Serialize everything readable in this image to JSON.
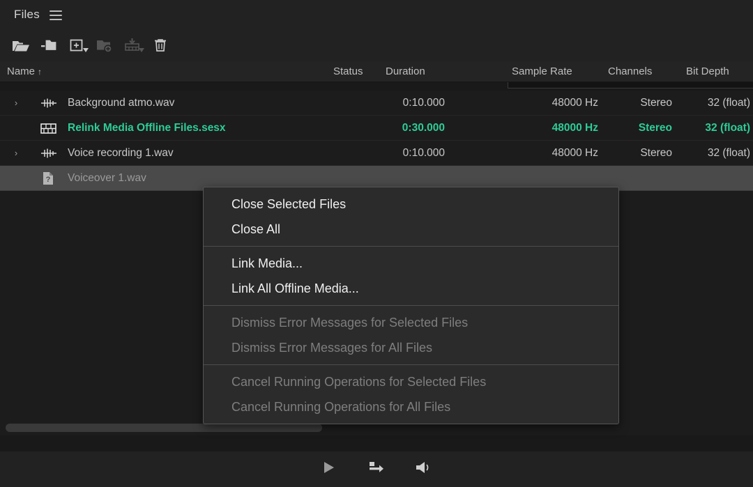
{
  "panel": {
    "title": "Files",
    "menu_icon": "hamburger-panel-menu-icon"
  },
  "toolbar": {
    "buttons": [
      {
        "name": "open-file",
        "icon": "open-folder-icon",
        "enabled": true,
        "has_dropdown": false
      },
      {
        "name": "import-file",
        "icon": "import-folder-arrow-icon",
        "enabled": true,
        "has_dropdown": false
      },
      {
        "name": "new-file",
        "icon": "new-file-plus-icon",
        "enabled": true,
        "has_dropdown": true
      },
      {
        "name": "new-folder",
        "icon": "new-folder-plus-icon",
        "enabled": false,
        "has_dropdown": false
      },
      {
        "name": "import-cd-track",
        "icon": "cd-import-down-arrow-icon",
        "enabled": false,
        "has_dropdown": true
      },
      {
        "name": "close-selected",
        "icon": "trash-can-icon",
        "enabled": true,
        "has_dropdown": false
      }
    ]
  },
  "search": {
    "icon": "search-magnifier-icon",
    "value": "",
    "placeholder": ""
  },
  "columns": [
    {
      "label": "Name",
      "sort": "↑"
    },
    {
      "label": "Status",
      "sort": ""
    },
    {
      "label": "Duration",
      "sort": ""
    },
    {
      "label": "Sample Rate",
      "sort": ""
    },
    {
      "label": "Channels",
      "sort": ""
    },
    {
      "label": "Bit Depth",
      "sort": ""
    }
  ],
  "rows": [
    {
      "name": "Background atmo.wav",
      "icon": "audio-waveform-icon",
      "twisty": "›",
      "status": "",
      "duration": "0:10.000",
      "sample_rate": "48000 Hz",
      "channels": "Stereo",
      "bit_depth": "32 (float)",
      "state": "normal"
    },
    {
      "name": "Relink Media Offline Files.sesx",
      "icon": "multitrack-session-icon",
      "twisty": "",
      "status": "",
      "duration": "0:30.000",
      "sample_rate": "48000 Hz",
      "channels": "Stereo",
      "bit_depth": "32 (float)",
      "state": "highlight"
    },
    {
      "name": "Voice recording 1.wav",
      "icon": "audio-waveform-icon",
      "twisty": "›",
      "status": "",
      "duration": "0:10.000",
      "sample_rate": "48000 Hz",
      "channels": "Stereo",
      "bit_depth": "32 (float)",
      "state": "normal"
    },
    {
      "name": "Voiceover 1.wav",
      "icon": "offline-media-question-icon",
      "twisty": "",
      "status": "",
      "duration": "",
      "sample_rate": "",
      "channels": "",
      "bit_depth": "",
      "state": "selected"
    }
  ],
  "context_menu": {
    "groups": [
      {
        "items": [
          {
            "label": "Close Selected Files",
            "enabled": true
          },
          {
            "label": "Close All",
            "enabled": true
          }
        ]
      },
      {
        "items": [
          {
            "label": "Link Media...",
            "enabled": true
          },
          {
            "label": "Link All Offline Media...",
            "enabled": true
          }
        ]
      },
      {
        "items": [
          {
            "label": "Dismiss Error Messages for Selected Files",
            "enabled": false
          },
          {
            "label": "Dismiss Error Messages for All Files",
            "enabled": false
          }
        ]
      },
      {
        "items": [
          {
            "label": "Cancel Running Operations for Selected Files",
            "enabled": false
          },
          {
            "label": "Cancel Running Operations for All Files",
            "enabled": false
          }
        ]
      }
    ]
  },
  "transport": {
    "buttons": [
      {
        "name": "play-button",
        "icon": "play-triangle-icon"
      },
      {
        "name": "insert-into-multitrack-button",
        "icon": "insert-arrow-box-icon"
      },
      {
        "name": "volume-button",
        "icon": "speaker-volume-icon"
      }
    ]
  },
  "colors": {
    "accent_green": "#2ecc98",
    "panel_bg": "#222222",
    "list_bg": "#1c1c1c",
    "selected_row": "#4a4a4a",
    "menu_bg": "#2b2b2b"
  }
}
